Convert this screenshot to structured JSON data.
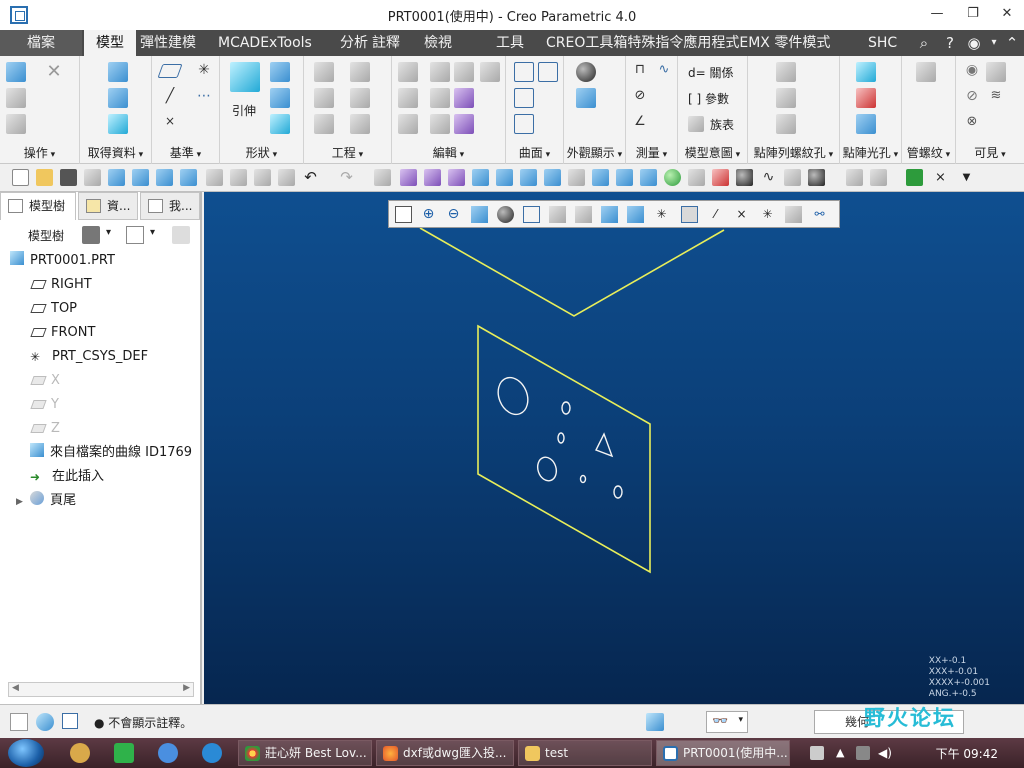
{
  "window": {
    "title": "PRT0001(使用中) - Creo Parametric 4.0",
    "minimize": "—",
    "restore": "❐",
    "close": "✕"
  },
  "tabs": [
    {
      "label": "檔案"
    },
    {
      "label": "模型"
    },
    {
      "label": "彈性建模"
    },
    {
      "label": "MCADExTools"
    },
    {
      "label": "分析"
    },
    {
      "label": "註釋"
    },
    {
      "label": "檢視"
    },
    {
      "label": "工具"
    },
    {
      "label": "CREO工具箱特殊指令應用程式EMX 零件模式"
    },
    {
      "label": "SHC"
    }
  ],
  "ribbon": {
    "groups": [
      {
        "label": "操作"
      },
      {
        "label": "取得資料"
      },
      {
        "label": "基準"
      },
      {
        "label": "形狀"
      },
      {
        "label": "工程"
      },
      {
        "label": "編輯"
      },
      {
        "label": "曲面"
      },
      {
        "label": "外觀顯示"
      },
      {
        "label": "測量"
      },
      {
        "label": "模型意圖"
      },
      {
        "label": "點陣列螺紋孔"
      },
      {
        "label": "點陣光孔"
      },
      {
        "label": "管螺纹"
      },
      {
        "label": "可見"
      }
    ],
    "extrude_label": "引伸",
    "relations_label": "d= 關係",
    "parameters_label": "[ ] 參數",
    "family_table_label": "族表"
  },
  "panel": {
    "tabs": [
      {
        "label": "模型樹"
      },
      {
        "label": "資..."
      },
      {
        "label": "我..."
      }
    ],
    "toolbar_label": "模型樹",
    "tree": [
      {
        "label": "PRT0001.PRT",
        "kind": "part",
        "dim": false
      },
      {
        "label": "RIGHT",
        "kind": "plane",
        "dim": false
      },
      {
        "label": "TOP",
        "kind": "plane",
        "dim": false
      },
      {
        "label": "FRONT",
        "kind": "plane",
        "dim": false
      },
      {
        "label": "PRT_CSYS_DEF",
        "kind": "csys",
        "dim": false
      },
      {
        "label": "X",
        "kind": "plane",
        "dim": true
      },
      {
        "label": "Y",
        "kind": "plane",
        "dim": true
      },
      {
        "label": "Z",
        "kind": "plane",
        "dim": true
      },
      {
        "label": "來自檔案的曲線 ID1769",
        "kind": "curve",
        "dim": false
      },
      {
        "label": "在此插入",
        "kind": "insert",
        "dim": false
      },
      {
        "label": "頁尾",
        "kind": "footer",
        "dim": false
      }
    ]
  },
  "viewport": {
    "tolerances": [
      "XX+-0.1",
      "XXX+-0.01",
      "XXXX+-0.001",
      "ANG.+-0.5"
    ],
    "sketch_color": "#e8ee5a",
    "background_top": "#0f4f90",
    "background_bottom": "#06264f"
  },
  "status": {
    "message": "不會顯示註釋。",
    "filter": "幾何"
  },
  "watermark": "野火论坛",
  "taskbar": {
    "tasks": [
      {
        "label": "莊心妍 Best Lov..."
      },
      {
        "label": "dxf或dwg匯入投..."
      },
      {
        "label": "test"
      },
      {
        "label": "PRT0001(使用中..."
      }
    ],
    "clock": "下午 09:42"
  }
}
